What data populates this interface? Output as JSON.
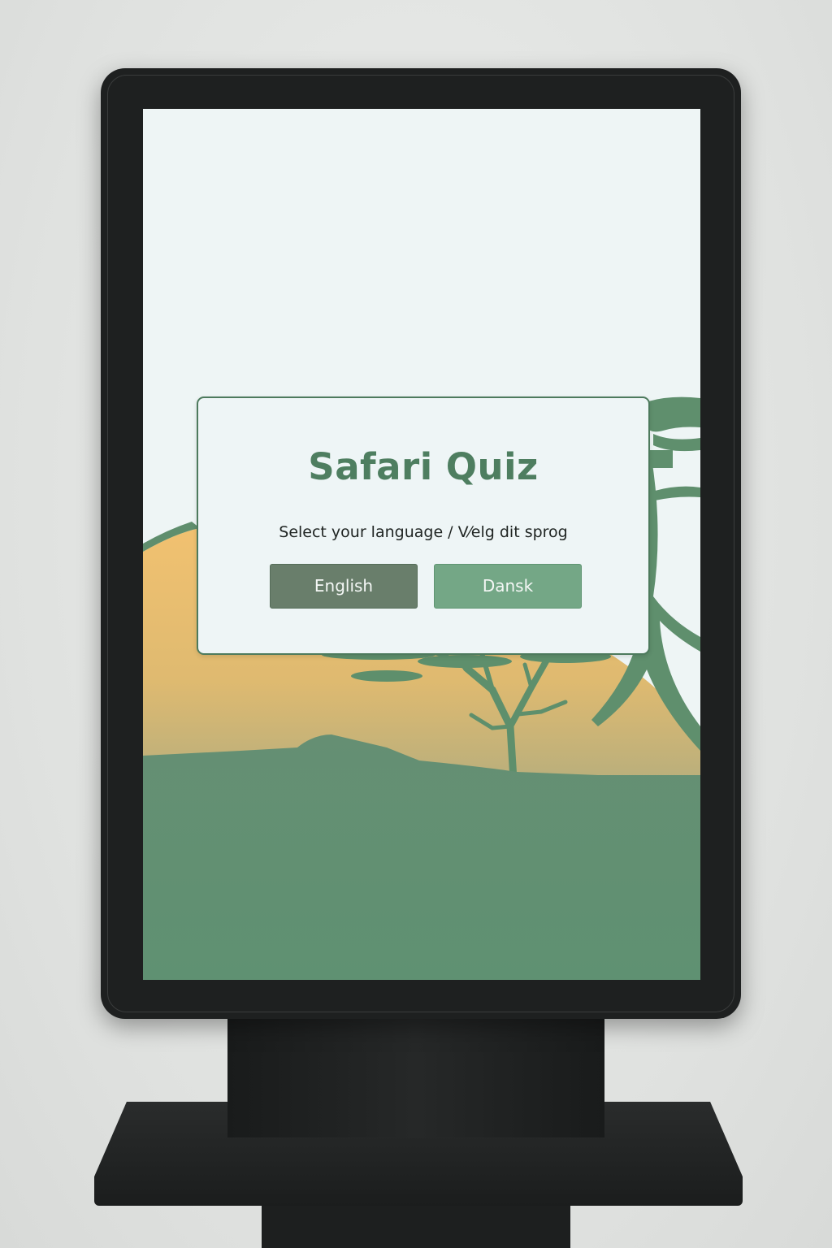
{
  "dialog": {
    "title": "Safari Quiz",
    "subtitle": "Select your language / V⁄elg dit sprog"
  },
  "buttons": {
    "english_label": "English",
    "danish_label": "Dansk"
  },
  "colors": {
    "title": "#4e7e60",
    "english_button": "#697e6b",
    "danish_button": "#74a786",
    "grass": "#638f72",
    "sun_top": "#f0c270",
    "sky": "#eef5f5",
    "kiosk_frame": "#1e2020"
  }
}
